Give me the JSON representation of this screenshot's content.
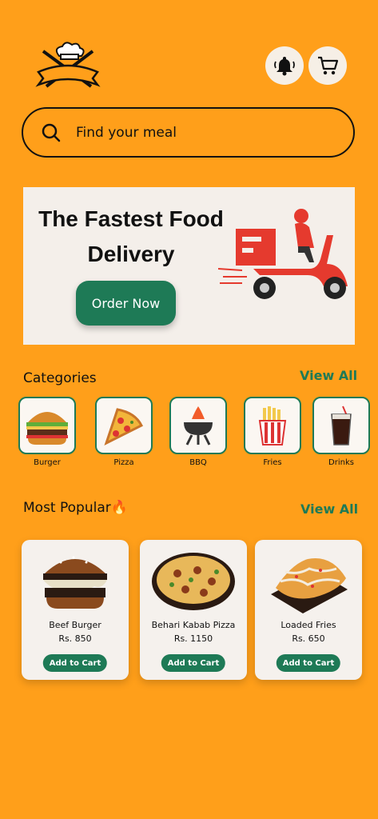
{
  "header": {
    "logo_icon": "chef-hat-utensils-logo",
    "bell_icon": "bell-icon",
    "cart_icon": "cart-icon"
  },
  "search": {
    "placeholder": "Find your meal"
  },
  "banner": {
    "title_line1": "The Fastest Food",
    "title_line2": "Delivery",
    "button_label": "Order Now"
  },
  "categories": {
    "title": "Categories",
    "view_all": "View All",
    "items": [
      {
        "label": "Burger",
        "icon": "burger-icon"
      },
      {
        "label": "Pizza",
        "icon": "pizza-icon"
      },
      {
        "label": "BBQ",
        "icon": "bbq-icon"
      },
      {
        "label": "Fries",
        "icon": "fries-icon"
      },
      {
        "label": "Drinks",
        "icon": "drink-icon"
      }
    ]
  },
  "popular": {
    "title": "Most Popular🔥",
    "view_all": "View All",
    "items": [
      {
        "name": "Beef Burger",
        "price": "Rs. 850",
        "button": "Add to Cart"
      },
      {
        "name": "Behari Kabab Pizza",
        "price": "Rs. 1150",
        "button": "Add to Cart"
      },
      {
        "name": "Loaded Fries",
        "price": "Rs. 650",
        "button": "Add to Cart"
      }
    ]
  },
  "colors": {
    "background": "#FF9F1A",
    "accent_green": "#1E7A56",
    "card": "#F5F1ED",
    "banner": "#F4EFEA"
  }
}
